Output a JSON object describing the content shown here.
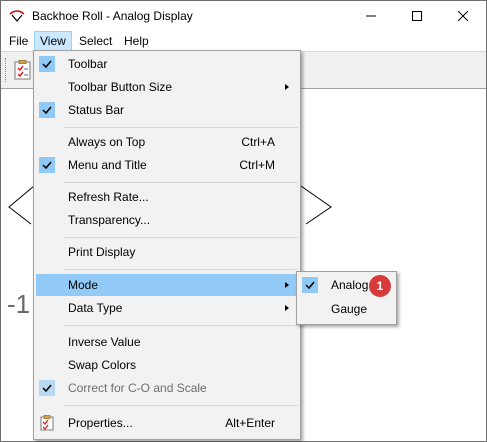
{
  "window": {
    "title": "Backhoe Roll - Analog Display",
    "controls": [
      "minimize",
      "maximize",
      "close"
    ]
  },
  "menubar": {
    "items": [
      {
        "label": "File"
      },
      {
        "label": "View",
        "active": true
      },
      {
        "label": "Select"
      },
      {
        "label": "Help"
      }
    ]
  },
  "content": {
    "scale_label": "-1"
  },
  "view_menu": {
    "items": [
      {
        "label": "Toolbar",
        "checked": true
      },
      {
        "label": "Toolbar Button Size",
        "submenu": true
      },
      {
        "label": "Status Bar",
        "checked": true
      },
      {
        "label": "Always on Top",
        "shortcut": "Ctrl+A"
      },
      {
        "label": "Menu and Title",
        "checked": true,
        "shortcut": "Ctrl+M"
      },
      {
        "label": "Refresh Rate..."
      },
      {
        "label": "Transparency..."
      },
      {
        "label": "Print Display"
      },
      {
        "label": "Mode",
        "submenu": true,
        "highlighted": true
      },
      {
        "label": "Data Type",
        "submenu": true
      },
      {
        "label": "Inverse Value"
      },
      {
        "label": "Swap Colors"
      },
      {
        "label": "Correct for C-O and Scale",
        "checked": true,
        "disabled": true
      },
      {
        "label": "Properties...",
        "shortcut": "Alt+Enter",
        "icon": "properties-icon"
      }
    ]
  },
  "mode_submenu": {
    "items": [
      {
        "label": "Analog",
        "checked": true
      },
      {
        "label": "Gauge"
      }
    ]
  },
  "callout": {
    "number": "1"
  },
  "colors": {
    "highlight": "#91c9f7",
    "check_bg": "#90c8f6",
    "badge": "#d73a3a"
  }
}
